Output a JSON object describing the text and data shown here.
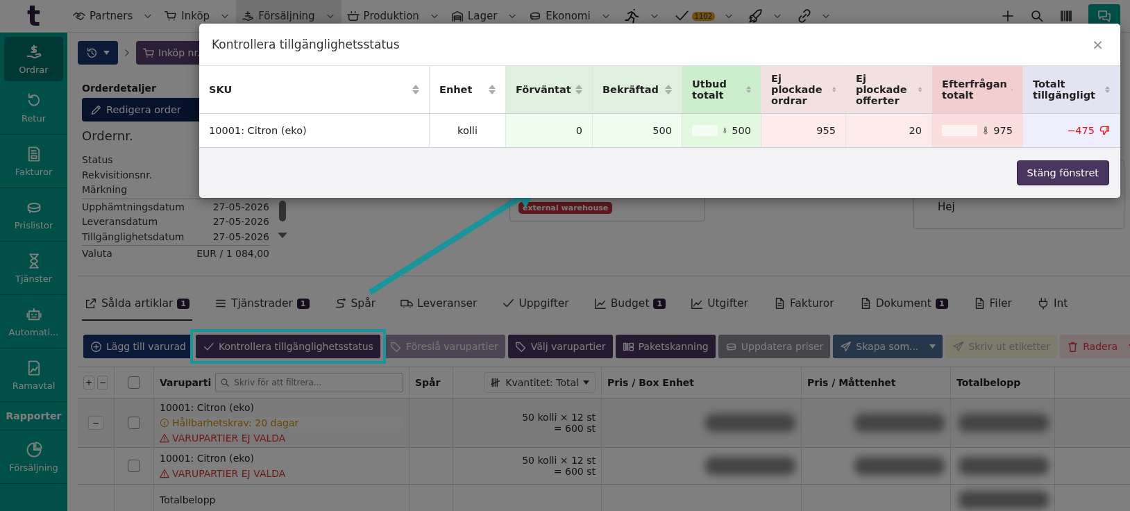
{
  "nav": {
    "logo": "t",
    "items": [
      {
        "label": "Partners",
        "selected": false
      },
      {
        "label": "Inköp",
        "selected": false
      },
      {
        "label": "Försäljning",
        "selected": true
      },
      {
        "label": "Produktion",
        "selected": false
      },
      {
        "label": "Lager",
        "selected": false
      },
      {
        "label": "Ekonomi",
        "selected": false
      }
    ],
    "task_badge": "1102"
  },
  "sidebar": [
    {
      "kind": "item",
      "label": "Ordrar",
      "selected": true
    },
    {
      "kind": "item",
      "label": "Retur",
      "selected": false
    },
    {
      "kind": "item",
      "label": "Fakturor",
      "selected": false
    },
    {
      "kind": "item",
      "label": "Prislistor",
      "selected": false
    },
    {
      "kind": "item",
      "label": "Tjänster",
      "selected": false
    },
    {
      "kind": "item",
      "label": "Automati...",
      "selected": false
    },
    {
      "kind": "item",
      "label": "Ramavtal",
      "selected": false
    },
    {
      "kind": "header",
      "label": "Rapporter"
    },
    {
      "kind": "item",
      "label": "Försäljning",
      "selected": false
    }
  ],
  "breadcrumb": {
    "order_button": "Inköp nr."
  },
  "order_details": {
    "title": "Orderdetaljer",
    "edit_button": "Redigera order",
    "order_number_label": "Ordernr.",
    "groups": [
      [
        {
          "label": "Status"
        },
        {
          "label": "Rekvisitionsnr."
        },
        {
          "label": "Märkning"
        }
      ],
      [
        {
          "label": "Upphämtningsdatum",
          "value": "27-05-2026"
        },
        {
          "label": "Leveransdatum",
          "value": "27-05-2026"
        },
        {
          "label": "Tillgänglighetsdatum",
          "value": "27-05-2026"
        }
      ],
      [
        {
          "label": "Valuta",
          "value": "EUR / 1 084,00"
        }
      ]
    ]
  },
  "warehouse_card": {
    "tag": "external warehouse"
  },
  "note_card": {
    "text": "Hej"
  },
  "tabs": [
    {
      "label": "Sålda artiklar",
      "count": "1",
      "selected": true
    },
    {
      "label": "Tjänstrader",
      "count": "1",
      "selected": false
    },
    {
      "label": "Spår",
      "selected": false
    },
    {
      "label": "Leveranser",
      "selected": false
    },
    {
      "label": "Uppgifter",
      "selected": false
    },
    {
      "label": "Budget",
      "count": "1",
      "selected": false
    },
    {
      "label": "Utgifter",
      "selected": false
    },
    {
      "label": "Fakturor",
      "selected": false
    },
    {
      "label": "Dokument",
      "count": "1",
      "selected": false
    },
    {
      "label": "Filer",
      "selected": false
    },
    {
      "label": "Int",
      "selected": false
    }
  ],
  "toolbar": [
    {
      "label": "Lägg till varurad",
      "kind": "navy"
    },
    {
      "label": "Kontrollera tillgänglighetsstatus",
      "kind": "purple",
      "highlighted": true
    },
    {
      "label": "Föreslå varupartier",
      "kind": "muted"
    },
    {
      "label": "Välj varupartier",
      "kind": "purple"
    },
    {
      "label": "Paketskanning",
      "kind": "purple"
    },
    {
      "label": "Uppdatera priser",
      "kind": "gray"
    },
    {
      "label": "Skapa som...",
      "kind": "blue",
      "dropdown": true
    },
    {
      "label": "Skriv ut etiketter",
      "kind": "yellow"
    },
    {
      "label": "Radera",
      "kind": "red",
      "dropdown": true
    }
  ],
  "items_table": {
    "all_checked": false,
    "expand_all": "+",
    "collapse_all": "−",
    "columns": {
      "lot": "Varuparti",
      "filter_placeholder": "Skriv för att filtrera...",
      "trace": "Spår",
      "quantity_select": "Kvantitet: Total",
      "price_box": "Pris / Box Enhet",
      "price_unit": "Pris / Måttenhet",
      "total": "Totalbelopp"
    },
    "rows": [
      {
        "toggle": "−",
        "checked": false,
        "name": "10001: Citron (eko)",
        "notes": [
          {
            "kind": "warning",
            "text": "Hållbarhetskrav: 20 dagar"
          },
          {
            "kind": "error",
            "text": "VARUPARTIER EJ VALDA"
          }
        ],
        "quantity": "50 kolli × 12 st",
        "quantity_total": "= 600 st"
      },
      {
        "checked": false,
        "name": "10001: Citron (eko)",
        "notes": [
          {
            "kind": "error",
            "text": "VARUPARTIER EJ VALDA"
          }
        ],
        "quantity": "50 kolli × 12 st",
        "quantity_total": "= 600 st"
      }
    ],
    "footer_label": "Totalbelopp"
  },
  "modal": {
    "title": "Kontrollera tillgänglighetsstatus",
    "close": "×",
    "columns": [
      {
        "label": "SKU",
        "kind": "sku"
      },
      {
        "label": "Enhet",
        "kind": "unit"
      },
      {
        "label": "Förväntat",
        "kind": "supply"
      },
      {
        "label": "Bekräftad",
        "kind": "supply"
      },
      {
        "label": "Utbud totalt",
        "kind": "supply_total"
      },
      {
        "label": "Ej plockade ordrar",
        "kind": "demand"
      },
      {
        "label": "Ej plockade offerter",
        "kind": "demand"
      },
      {
        "label": "Efterfrågan totalt",
        "kind": "demand_total"
      },
      {
        "label": "Totalt tillgängligt",
        "kind": "available"
      }
    ],
    "rows": [
      {
        "cells": [
          {
            "text": "10001: Citron (eko)"
          },
          {
            "text": "kolli"
          },
          {
            "text": "0"
          },
          {
            "text": "500"
          },
          {
            "text": "500"
          },
          {
            "text": "955"
          },
          {
            "text": "20"
          },
          {
            "text": "975"
          },
          {
            "text": "−475",
            "negative": true
          }
        ]
      }
    ],
    "close_button": "Stäng fönstret"
  }
}
